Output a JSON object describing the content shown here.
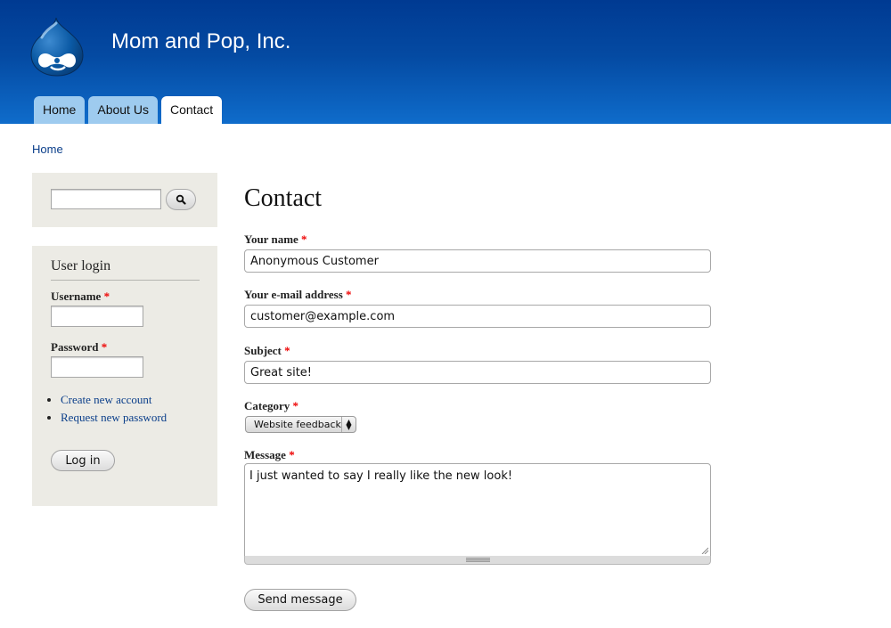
{
  "site": {
    "name": "Mom and Pop, Inc.",
    "logo_icon": "drupal-drop-logo",
    "colors": {
      "header_top": "#003a92",
      "header_bottom": "#0f6ccb",
      "tab_inactive": "#9ecbef",
      "tab_active": "#ffffff",
      "sidebar_bg": "#ecebe5",
      "link": "#0a3e8a",
      "required": "#e00000"
    }
  },
  "nav": {
    "tabs": [
      {
        "label": "Home",
        "active": false
      },
      {
        "label": "About Us",
        "active": false
      },
      {
        "label": "Contact",
        "active": true
      }
    ]
  },
  "breadcrumb": {
    "items": [
      "Home"
    ]
  },
  "sidebar": {
    "search": {
      "value": "",
      "button_icon": "search-icon"
    },
    "login": {
      "title": "User login",
      "username_label": "Username",
      "password_label": "Password",
      "required_marker": "*",
      "username_value": "",
      "password_value": "",
      "links": [
        "Create new account",
        "Request new password"
      ],
      "submit_label": "Log in"
    }
  },
  "main": {
    "title": "Contact",
    "required_marker": "*",
    "fields": {
      "name": {
        "label": "Your name",
        "value": "Anonymous Customer"
      },
      "email": {
        "label": "Your e-mail address",
        "value": "customer@example.com"
      },
      "subject": {
        "label": "Subject",
        "value": "Great site!"
      },
      "category": {
        "label": "Category",
        "value": "Website feedback"
      },
      "message": {
        "label": "Message",
        "value": "I just wanted to say I really like the new look!"
      }
    },
    "submit_label": "Send message"
  }
}
